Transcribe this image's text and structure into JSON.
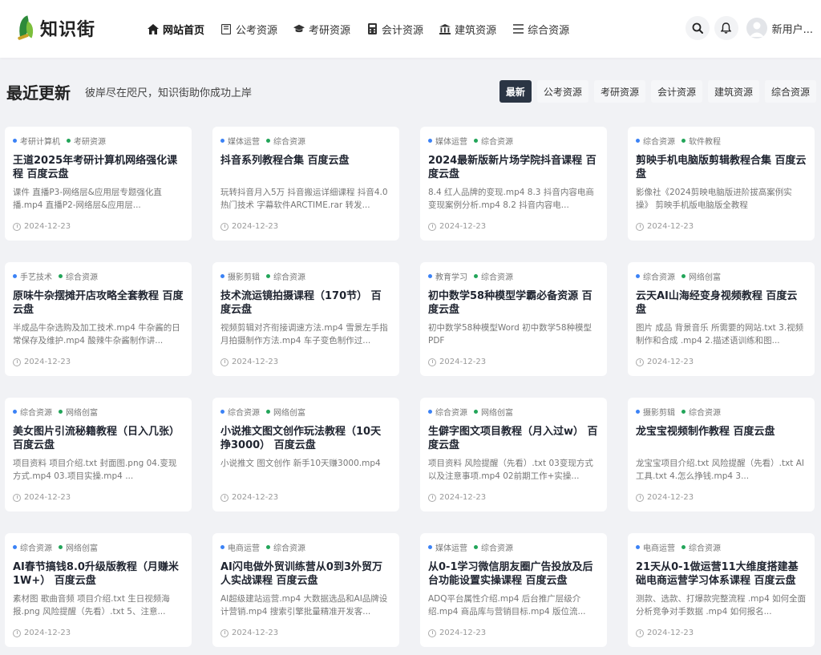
{
  "brand": {
    "name": "知识街"
  },
  "nav": [
    {
      "label": "网站首页",
      "icon": "home-icon",
      "active": true
    },
    {
      "label": "公考资源",
      "icon": "book-icon",
      "active": false
    },
    {
      "label": "考研资源",
      "icon": "graduation-cap-icon",
      "active": false
    },
    {
      "label": "会计资源",
      "icon": "calculator-icon",
      "active": false
    },
    {
      "label": "建筑资源",
      "icon": "bank-building-icon",
      "active": false
    },
    {
      "label": "综合资源",
      "icon": "list-icon",
      "active": false
    }
  ],
  "header": {
    "user_name": "新用户..."
  },
  "section": {
    "title": "最近更新",
    "subtitle": "彼岸尽在咫尺，知识街助你成功上岸",
    "filters": [
      "最新",
      "公考资源",
      "考研资源",
      "会计资源",
      "建筑资源",
      "综合资源"
    ]
  },
  "cards": [
    {
      "tags": [
        "考研计算机",
        "考研资源"
      ],
      "title": "王道2025年考研计算机网络强化课程 百度云盘",
      "desc": "课件 直播P3-网络层&应用层专题强化直播.mp4 直播P2-网络层&应用层...",
      "date": "2024-12-23"
    },
    {
      "tags": [
        "媒体运营",
        "综合资源"
      ],
      "title": "抖音系列教程合集 百度云盘",
      "desc": "玩转抖音月入5万 抖音搬运详细课程 抖音4.0热门技术 字幕软件ARCTIME.rar 转发...",
      "date": "2024-12-23"
    },
    {
      "tags": [
        "媒体运营",
        "综合资源"
      ],
      "title": "2024最新版新片场学院抖音课程 百度云盘",
      "desc": "8.4 红人品牌的变现.mp4 8.3 抖音内容电商变现案例分析.mp4 8.2 抖音内容电...",
      "date": "2024-12-23"
    },
    {
      "tags": [
        "综合资源",
        "软件教程"
      ],
      "title": "剪映手机电脑版剪辑教程合集 百度云盘",
      "desc": "影像社《2024剪映电脑版进阶拔高案例实操》 剪映手机版电脑版全教程",
      "date": "2024-12-23"
    },
    {
      "tags": [
        "手艺技术",
        "综合资源"
      ],
      "title": "原味牛杂摆摊开店攻略全套教程 百度云盘",
      "desc": "半成品牛杂选购及加工技术.mp4 牛杂酱的日常保存及维护.mp4 酸辣牛杂酱制作讲...",
      "date": "2024-12-23"
    },
    {
      "tags": [
        "摄影剪辑",
        "综合资源"
      ],
      "title": "技术流运镜拍摄课程（170节） 百度云盘",
      "desc": "视频剪辑对齐衔接调速方法.mp4 雪景左手指月拍摄制作方法.mp4 车子变色制作过...",
      "date": "2024-12-23"
    },
    {
      "tags": [
        "教育学习",
        "综合资源"
      ],
      "title": "初中数学58种模型学霸必备资源 百度云盘",
      "desc": "初中数学58种模型Word 初中数学58种模型PDF",
      "date": "2024-12-23"
    },
    {
      "tags": [
        "综合资源",
        "网络创富"
      ],
      "title": "云天AI山海经变身视频教程 百度云盘",
      "desc": "图片 成品 背景音乐 所需要的网站.txt 3.视频制作和合成 .mp4 2.描述语训练和图...",
      "date": "2024-12-23"
    },
    {
      "tags": [
        "综合资源",
        "网络创富"
      ],
      "title": "美女图片引流秘籍教程（日入几张） 百度云盘",
      "desc": "项目资料 项目介绍.txt 封面图.png 04.变现方式.mp4 03.项目实操.mp4 ...",
      "date": "2024-12-23"
    },
    {
      "tags": [
        "综合资源",
        "网络创富"
      ],
      "title": "小说推文图文创作玩法教程（10天挣3000） 百度云盘",
      "desc": "小说推文 图文创作 新手10天赚3000.mp4",
      "date": "2024-12-23"
    },
    {
      "tags": [
        "综合资源",
        "网络创富"
      ],
      "title": "生僻字图文项目教程（月入过w） 百度云盘",
      "desc": "项目资料 风险提醒（先看）.txt 03变现方式以及注意事项.mp4 02前期工作+实操...",
      "date": "2024-12-23"
    },
    {
      "tags": [
        "摄影剪辑",
        "综合资源"
      ],
      "title": "龙宝宝视频制作教程 百度云盘",
      "desc": "龙宝宝项目介绍.txt 风险提醒（先看）.txt AI工具.txt 4.怎么挣钱.mp4 3...",
      "date": "2024-12-23"
    },
    {
      "tags": [
        "综合资源",
        "网络创富"
      ],
      "title": "AI春节搞钱8.0升级版教程（月赚米1W+） 百度云盘",
      "desc": "素材图 歌曲音频 项目介绍.txt 生日视频海报.png 风险提醒（先看）.txt 5、注意...",
      "date": "2024-12-23"
    },
    {
      "tags": [
        "电商运营",
        "综合资源"
      ],
      "title": "AI闪电做外贸训练营从0到3外贸万人实战课程 百度云盘",
      "desc": "AI超级建站运营.mp4 大数据选品和AI品牌设计营销.mp4 搜索引擎批量精准开发客...",
      "date": "2024-12-23"
    },
    {
      "tags": [
        "媒体运营",
        "综合资源"
      ],
      "title": "从0-1学习微信朋友圈广告投放及后台功能设置实操课程 百度云盘",
      "desc": "ADQ平台属性介绍.mp4 后台推广层级介绍.mp4 商品库与营销目标.mp4 版位流...",
      "date": "2024-12-23"
    },
    {
      "tags": [
        "电商运营",
        "综合资源"
      ],
      "title": "21天从0-1做运营11大维度搭建基础电商运营学习体系课程 百度云盘",
      "desc": "测款、选款、打爆款完整流程 .mp4 如何全面分析竞争对手数据 .mp4 如何报名...",
      "date": "2024-12-23"
    }
  ]
}
